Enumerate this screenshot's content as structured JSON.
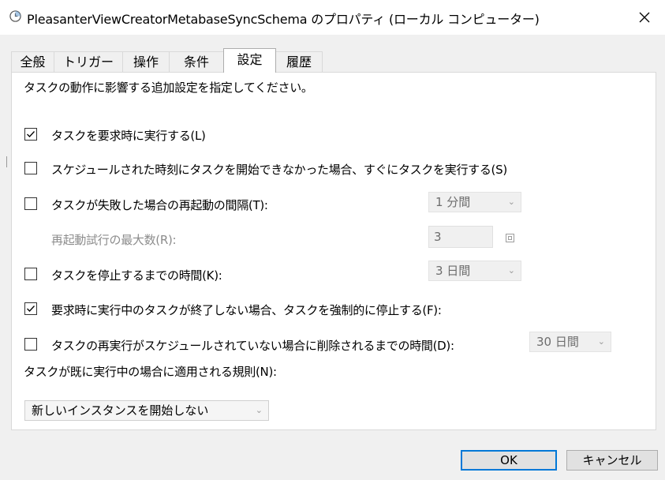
{
  "window": {
    "title": "PleasanterViewCreatorMetabaseSyncSchema のプロパティ (ローカル コンピューター)",
    "icon": "clock-icon",
    "close_glyph": "✕"
  },
  "tabs": [
    {
      "label": "全般"
    },
    {
      "label": "トリガー"
    },
    {
      "label": "操作"
    },
    {
      "label": "条件"
    },
    {
      "label": "設定",
      "active": true
    },
    {
      "label": "履歴"
    }
  ],
  "settings": {
    "description": "タスクの動作に影響する追加設定を指定してください。",
    "run_on_demand": {
      "label": "タスクを要求時に実行する(L)",
      "checked": true
    },
    "run_after_missed": {
      "label": "スケジュールされた時刻にタスクを開始できなかった場合、すぐにタスクを実行する(S)",
      "checked": false
    },
    "restart_on_failure": {
      "label": "タスクが失敗した場合の再起動の間隔(T):",
      "checked": false,
      "value": "1 分間"
    },
    "restart_attempts": {
      "label": "再起動試行の最大数(R):",
      "value": "3"
    },
    "stop_after": {
      "label": "タスクを停止するまでの時間(K):",
      "checked": false,
      "value": "3 日間"
    },
    "force_stop": {
      "label": "要求時に実行中のタスクが終了しない場合、タスクを強制的に停止する(F):",
      "checked": true
    },
    "delete_after": {
      "label": "タスクの再実行がスケジュールされていない場合に削除されるまでの時間(D):",
      "checked": false,
      "value": "30 日間"
    },
    "rule_label": "タスクが既に実行中の場合に適用される規則(N):",
    "rule_value": "新しいインスタンスを開始しない",
    "dropdown_arrow": "⌄"
  },
  "buttons": {
    "ok": "OK",
    "cancel": "キャンセル"
  },
  "colors": {
    "accent": "#0078d7",
    "dialog_bg": "#f0f0f0",
    "panel_bg": "#ffffff",
    "disabled_text": "#8c8c8c"
  }
}
